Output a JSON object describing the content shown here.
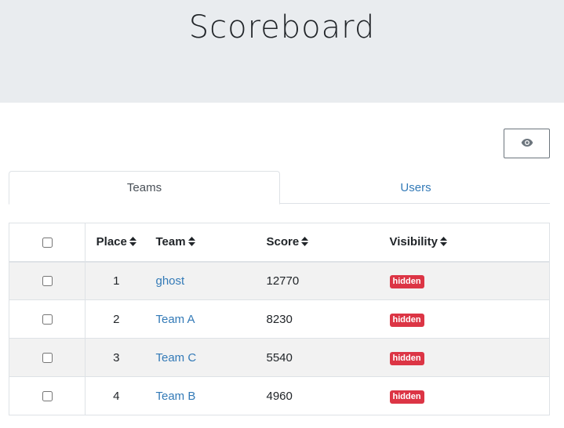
{
  "header": {
    "title": "Scoreboard"
  },
  "toolbar": {
    "visibility_toggle_icon": "eye-icon"
  },
  "tabs": [
    {
      "label": "Teams",
      "active": true
    },
    {
      "label": "Users",
      "active": false
    }
  ],
  "table": {
    "columns": {
      "place": "Place",
      "team": "Team",
      "score": "Score",
      "visibility": "Visibility"
    },
    "rows": [
      {
        "place": "1",
        "team": "ghost",
        "score": "12770",
        "visibility": "hidden"
      },
      {
        "place": "2",
        "team": "Team A",
        "score": "8230",
        "visibility": "hidden"
      },
      {
        "place": "3",
        "team": "Team C",
        "score": "5540",
        "visibility": "hidden"
      },
      {
        "place": "4",
        "team": "Team B",
        "score": "4960",
        "visibility": "hidden"
      }
    ]
  },
  "colors": {
    "link": "#337ab7",
    "badge_hidden": "#dc3545",
    "header_bg": "#e9ecef"
  }
}
